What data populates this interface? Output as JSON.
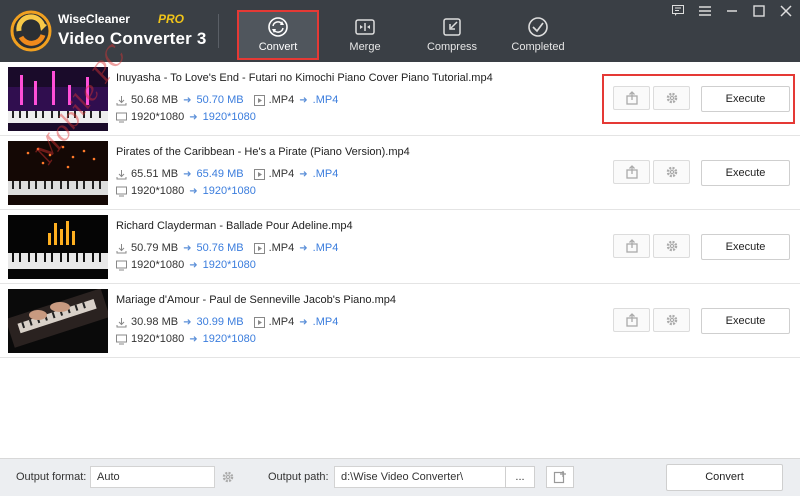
{
  "brand": {
    "top": "WiseCleaner",
    "pro": "PRO",
    "title": "Video Converter 3"
  },
  "tabs": [
    {
      "label": "Convert",
      "icon": "convert-icon",
      "active": true
    },
    {
      "label": "Merge",
      "icon": "merge-icon"
    },
    {
      "label": "Compress",
      "icon": "compress-icon"
    },
    {
      "label": "Completed",
      "icon": "completed-icon"
    }
  ],
  "window_controls": [
    "feedback-icon",
    "menu-icon",
    "minimize-icon",
    "maximize-icon",
    "close-icon"
  ],
  "watermark": "Mobile PC",
  "files": [
    {
      "name": "Inuyasha - To Love's End - Futari no Kimochi Piano Cover Piano Tutorial.mp4",
      "size_old": "50.68 MB",
      "size_new": "50.70 MB",
      "fmt_old": ".MP4",
      "fmt_new": ".MP4",
      "res_old": "1920*1080",
      "res_new": "1920*1080",
      "execute": "Execute"
    },
    {
      "name": "Pirates of the Caribbean - He's a Pirate (Piano Version).mp4",
      "size_old": "65.51 MB",
      "size_new": "65.49 MB",
      "fmt_old": ".MP4",
      "fmt_new": ".MP4",
      "res_old": "1920*1080",
      "res_new": "1920*1080",
      "execute": "Execute"
    },
    {
      "name": "Richard Clayderman - Ballade Pour Adeline.mp4",
      "size_old": "50.79 MB",
      "size_new": "50.76 MB",
      "fmt_old": ".MP4",
      "fmt_new": ".MP4",
      "res_old": "1920*1080",
      "res_new": "1920*1080",
      "execute": "Execute"
    },
    {
      "name": "Mariage d'Amour - Paul de Senneville Jacob's Piano.mp4",
      "size_old": "30.98 MB",
      "size_new": "30.99 MB",
      "fmt_old": ".MP4",
      "fmt_new": ".MP4",
      "res_old": "1920*1080",
      "res_new": "1920*1080",
      "execute": "Execute"
    }
  ],
  "footer": {
    "format_label": "Output format:",
    "format_value": "Auto",
    "path_label": "Output path:",
    "path_value": "d:\\Wise Video Converter\\",
    "browse": "...",
    "convert": "Convert"
  },
  "colors": {
    "header_bg": "#3a3f45",
    "accent": "#3b7ddd",
    "highlight": "#e53935"
  }
}
